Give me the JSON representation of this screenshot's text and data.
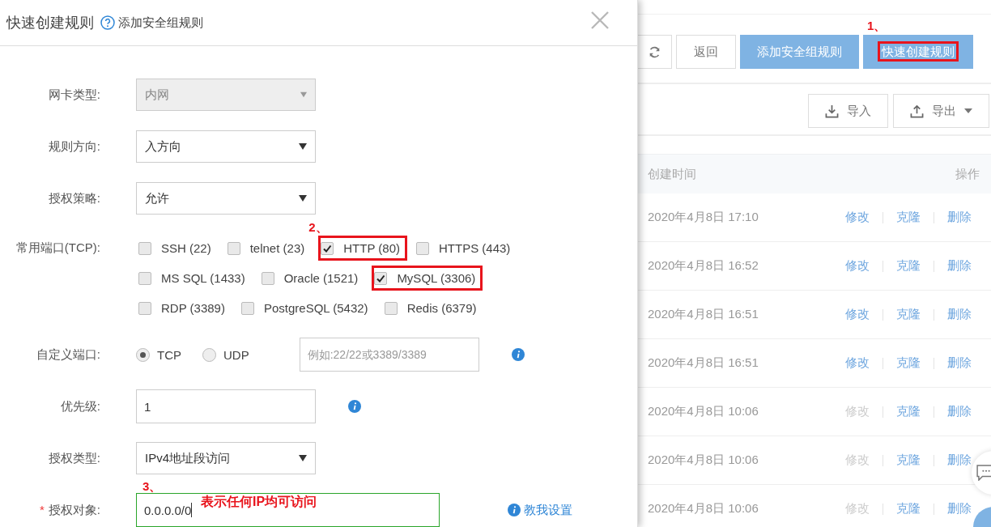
{
  "dialog": {
    "title": "快速创建规则",
    "subtitle": "添加安全组规则",
    "fields": [
      {
        "kind": "select",
        "label": "网卡类型:",
        "value": "内网",
        "disabled": true
      },
      {
        "kind": "select",
        "label": "规则方向:",
        "value": "入方向",
        "disabled": false
      },
      {
        "kind": "select",
        "label": "授权策略:",
        "value": "允许",
        "disabled": false
      },
      {
        "kind": "checkboxes",
        "label": "常用端口(TCP):",
        "options": [
          {
            "label": "SSH (22)",
            "checked": false,
            "highlighted": false
          },
          {
            "label": "telnet (23)",
            "checked": false,
            "highlighted": false
          },
          {
            "label": "HTTP (80)",
            "checked": true,
            "highlighted": true,
            "annotation": "2、"
          },
          {
            "label": "HTTPS (443)",
            "checked": false,
            "highlighted": false
          },
          {
            "label": "MS SQL (1433)",
            "checked": false,
            "highlighted": false
          },
          {
            "label": "Oracle (1521)",
            "checked": false,
            "highlighted": false
          },
          {
            "label": "MySQL (3306)",
            "checked": true,
            "highlighted": true
          },
          {
            "label": "RDP (3389)",
            "checked": false,
            "highlighted": false
          },
          {
            "label": "PostgreSQL (5432)",
            "checked": false,
            "highlighted": false
          },
          {
            "label": "Redis (6379)",
            "checked": false,
            "highlighted": false
          }
        ]
      },
      {
        "kind": "port",
        "label": "自定义端口:",
        "protocols": [
          {
            "label": "TCP",
            "selected": true
          },
          {
            "label": "UDP",
            "selected": false
          }
        ],
        "placeholder": "例如:22/22或3389/3389",
        "info": true
      },
      {
        "kind": "text",
        "label": "优先级:",
        "value": "1",
        "info": true
      },
      {
        "kind": "select",
        "label": "授权类型:",
        "value": "IPv4地址段访问",
        "disabled": false
      },
      {
        "kind": "text",
        "label": "授权对象:",
        "value": "0.0.0.0/0",
        "required_mark": "*",
        "focused": true,
        "annotation": "3、",
        "note": "表示任何IP均可访问",
        "help": "教我设置"
      }
    ]
  },
  "page": {
    "buttons": [
      {
        "label": "返回",
        "primary": false,
        "highlighted": false
      },
      {
        "label": "添加安全组规则",
        "primary": true,
        "highlighted": false
      },
      {
        "label": "快速创建规则",
        "primary": true,
        "highlighted": true,
        "annotation": "1、"
      }
    ],
    "io_buttons": [
      {
        "label": "导入",
        "kind": "import"
      },
      {
        "label": "导出",
        "kind": "export"
      }
    ],
    "table": {
      "columns": [
        "创建时间",
        "操作"
      ],
      "rows": [
        {
          "time": "2020年4月8日 17:10",
          "actions": [
            {
              "label": "修改",
              "disabled": false
            },
            {
              "label": "克隆",
              "disabled": false
            },
            {
              "label": "删除",
              "disabled": false
            }
          ]
        },
        {
          "time": "2020年4月8日 16:52",
          "actions": [
            {
              "label": "修改",
              "disabled": false
            },
            {
              "label": "克隆",
              "disabled": false
            },
            {
              "label": "删除",
              "disabled": false
            }
          ]
        },
        {
          "time": "2020年4月8日 16:51",
          "actions": [
            {
              "label": "修改",
              "disabled": false
            },
            {
              "label": "克隆",
              "disabled": false
            },
            {
              "label": "删除",
              "disabled": false
            }
          ]
        },
        {
          "time": "2020年4月8日 16:51",
          "actions": [
            {
              "label": "修改",
              "disabled": false
            },
            {
              "label": "克隆",
              "disabled": false
            },
            {
              "label": "删除",
              "disabled": false
            }
          ]
        },
        {
          "time": "2020年4月8日 10:06",
          "actions": [
            {
              "label": "修改",
              "disabled": true
            },
            {
              "label": "克隆",
              "disabled": false
            },
            {
              "label": "删除",
              "disabled": false
            }
          ]
        },
        {
          "time": "2020年4月8日 10:06",
          "actions": [
            {
              "label": "修改",
              "disabled": true
            },
            {
              "label": "克隆",
              "disabled": false
            },
            {
              "label": "删除",
              "disabled": false
            }
          ]
        },
        {
          "time": "2020年4月8日 10:06",
          "actions": [
            {
              "label": "修改",
              "disabled": true
            },
            {
              "label": "克隆",
              "disabled": false
            },
            {
              "label": "删除",
              "disabled": false
            }
          ]
        }
      ]
    }
  }
}
